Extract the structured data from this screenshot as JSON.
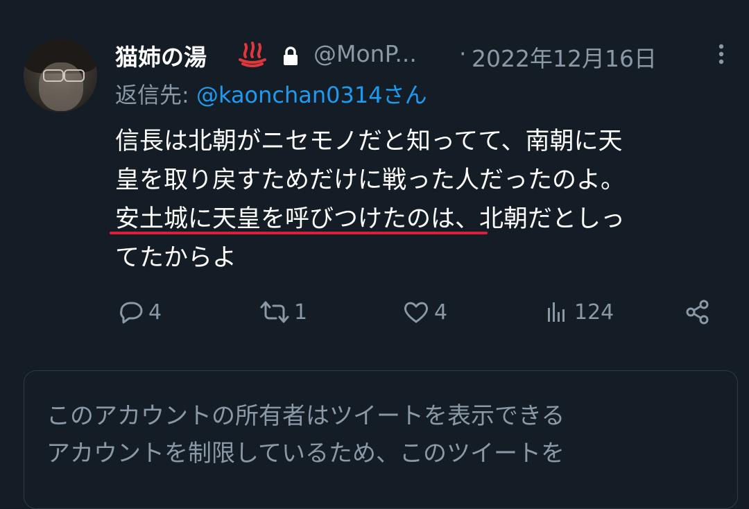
{
  "tweet": {
    "display_name": "猫姉の湯",
    "name_emoji": "hot-springs-icon",
    "locked_icon": "lock-icon",
    "handle": "@MonP...",
    "separator": "·",
    "date": "2022年12月16日",
    "reply_prefix": "返信先: ",
    "reply_mention": "@kaonchan0314さん",
    "body_lines": [
      "信長は北朝がニセモノだと知ってて、南朝に天",
      "皇を取り戻すためだけに戦った人だったのよ。",
      "安土城に天皇を呼びつけたのは、北朝だとしっ",
      "てたからよ"
    ],
    "highlight_color": "#d91f3a"
  },
  "actions": {
    "replies": "4",
    "retweets": "1",
    "likes": "4",
    "views": "124"
  },
  "restricted_notice": {
    "lines": [
      "このアカウントの所有者はツイートを表示できる",
      "アカウントを制限しているため、このツイートを"
    ]
  },
  "colors": {
    "background": "#141d26",
    "secondary_text": "#8b98a5",
    "link": "#1d9bf0"
  }
}
